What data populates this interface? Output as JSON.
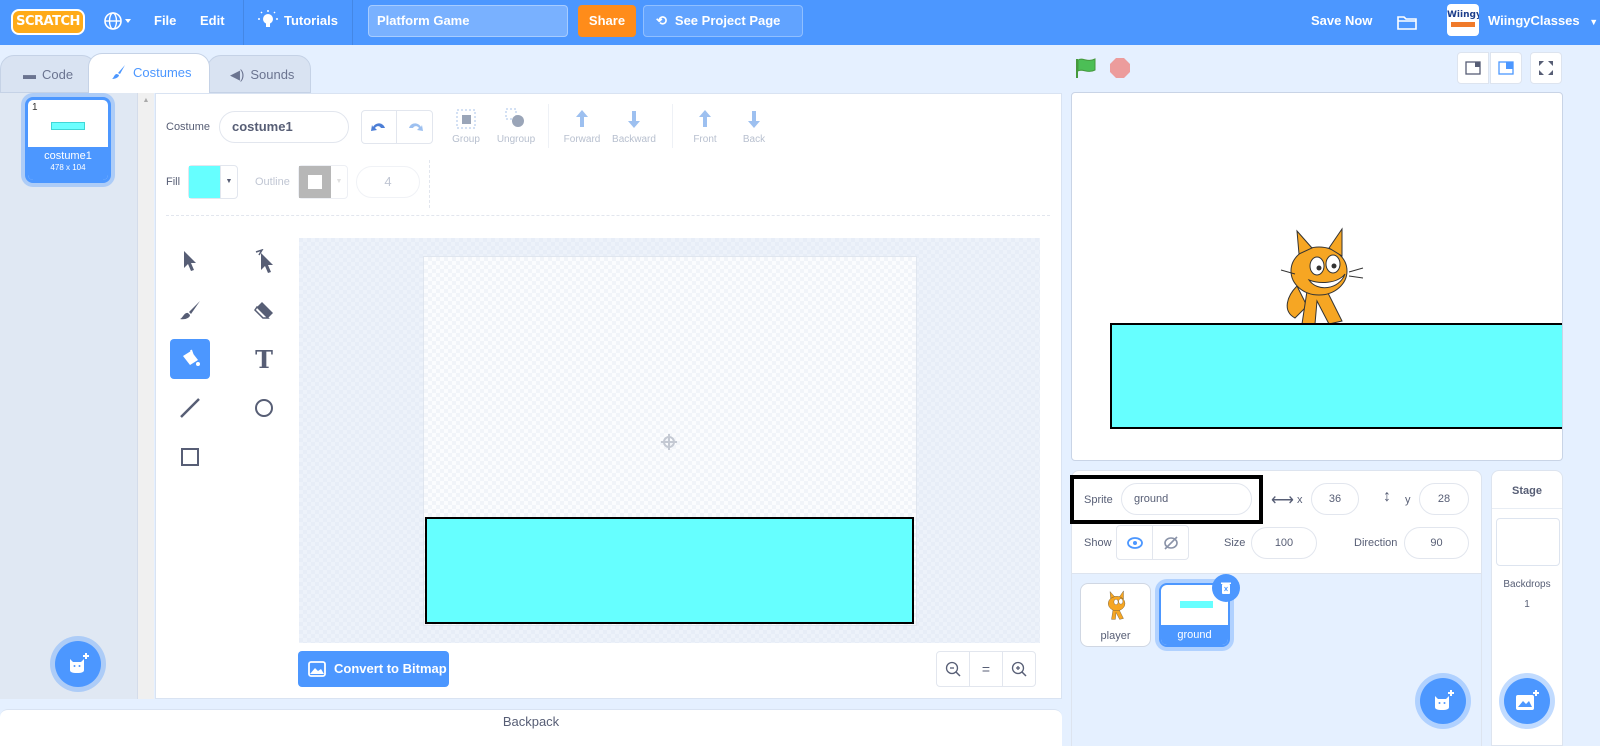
{
  "menubar": {
    "logo": "SCRATCH",
    "file": "File",
    "edit": "Edit",
    "tutorials": "Tutorials",
    "project_title": "Platform Game",
    "share": "Share",
    "see_project_page": "See Project Page",
    "save_now": "Save Now",
    "username": "WiingyClasses",
    "avatar_text": "Wiingy"
  },
  "tabs": [
    {
      "label": "Code",
      "icon": "code-icon"
    },
    {
      "label": "Costumes",
      "icon": "brush-icon",
      "active": true
    },
    {
      "label": "Sounds",
      "icon": "speaker-icon"
    }
  ],
  "costumes": [
    {
      "index": "1",
      "name": "costume1",
      "size": "478 x 104",
      "selected": true
    }
  ],
  "paint_editor": {
    "costume_label": "Costume",
    "costume_name": "costume1",
    "fill_label": "Fill",
    "fill_color": "#66ffff",
    "outline_label": "Outline",
    "outline_width": "4",
    "actions": {
      "group": "Group",
      "ungroup": "Ungroup",
      "forward": "Forward",
      "backward": "Backward",
      "front": "Front",
      "back": "Back"
    },
    "tools": [
      "select",
      "reshape",
      "brush",
      "eraser",
      "fill",
      "text",
      "line",
      "circle",
      "rectangle"
    ],
    "active_tool": "fill",
    "convert_button": "Convert to Bitmap",
    "zoom_reset": "="
  },
  "backpack": {
    "label": "Backpack"
  },
  "sprite_info": {
    "sprite_label": "Sprite",
    "sprite_name": "ground",
    "x_label": "x",
    "x_value": "36",
    "y_label": "y",
    "y_value": "28",
    "show_label": "Show",
    "size_label": "Size",
    "size_value": "100",
    "direction_label": "Direction",
    "direction_value": "90"
  },
  "sprites": [
    {
      "name": "player",
      "selected": false
    },
    {
      "name": "ground",
      "selected": true
    }
  ],
  "stage_panel": {
    "title": "Stage",
    "backdrops_label": "Backdrops",
    "backdrops_count": "1"
  },
  "colors": {
    "accent": "#4c97ff",
    "share": "#ff8c1a",
    "ground_fill": "#66ffff",
    "flag": "#4cbf56",
    "stop": "#ec9c9c"
  }
}
